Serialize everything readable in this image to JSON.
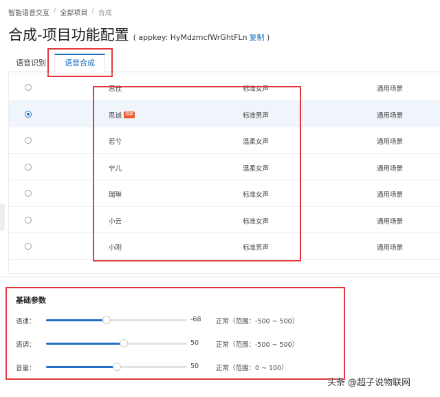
{
  "breadcrumb": {
    "item1": "智能语音交互",
    "item2": "全部项目",
    "current": "合成",
    "separator": "/"
  },
  "header": {
    "title": "合成-项目功能配置",
    "appkey_prefix": "( appkey: HyMdzmcfWrGhtFLn",
    "copy_label": "复制",
    "appkey_suffix": ")"
  },
  "tabs": [
    {
      "label": "语音识别"
    },
    {
      "label": "语音合成"
    }
  ],
  "voices": [
    {
      "name": "思佳",
      "type": "标准女声",
      "scene": "通用场景",
      "selected": false,
      "badge": ""
    },
    {
      "name": "思诚",
      "type": "标准男声",
      "scene": "通用场景",
      "selected": true,
      "badge": "推荐"
    },
    {
      "name": "若兮",
      "type": "温柔女声",
      "scene": "通用场景",
      "selected": false,
      "badge": ""
    },
    {
      "name": "宁儿",
      "type": "温柔女声",
      "scene": "通用场景",
      "selected": false,
      "badge": ""
    },
    {
      "name": "瑞琳",
      "type": "标准女声",
      "scene": "通用场景",
      "selected": false,
      "badge": ""
    },
    {
      "name": "小云",
      "type": "标准女声",
      "scene": "通用场景",
      "selected": false,
      "badge": ""
    },
    {
      "name": "小刚",
      "type": "标准男声",
      "scene": "通用场景",
      "selected": false,
      "badge": ""
    }
  ],
  "basic": {
    "title": "基础参数",
    "params": [
      {
        "label": "语速：",
        "value": "-68",
        "fraction": 0.43,
        "status": "正常（范围：-500 ~ 500）"
      },
      {
        "label": "语调：",
        "value": "50",
        "fraction": 0.55,
        "status": "正常（范围：-500 ~ 500）"
      },
      {
        "label": "音量：",
        "value": "50",
        "fraction": 0.5,
        "status": "正常（范围：0 ~ 100）"
      }
    ]
  },
  "watermark": "头条 @超子说物联网",
  "colors": {
    "accent": "#1f6fc7",
    "highlight_box": "#e4363c",
    "badge": "#f05a28"
  }
}
